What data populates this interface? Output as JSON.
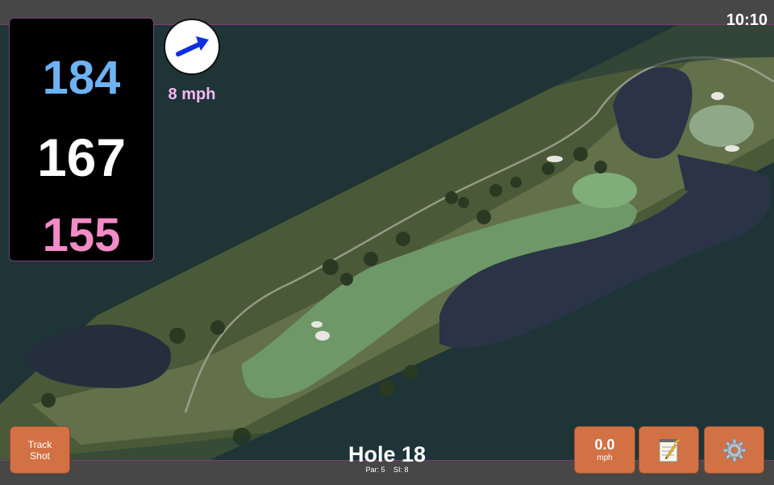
{
  "status": {
    "time": "10:10"
  },
  "distances": {
    "back": "184",
    "middle": "167",
    "front": "155"
  },
  "wind": {
    "speed_label": "8 mph",
    "arrow_color": "#1030e0"
  },
  "hole": {
    "title": "Hole 18",
    "par": "Par: 5",
    "si": "SI: 8"
  },
  "buttons": {
    "track_shot": [
      "Track",
      "Shot"
    ],
    "speed_value": "0.0",
    "speed_unit": "mph",
    "notes_icon": "notepad-icon",
    "settings_icon": "gear-icon"
  },
  "colors": {
    "accent_button": "#d27244",
    "distance_back": "#6fb2f2",
    "distance_front": "#f28bc6",
    "wind_text": "#f4b8f4"
  }
}
